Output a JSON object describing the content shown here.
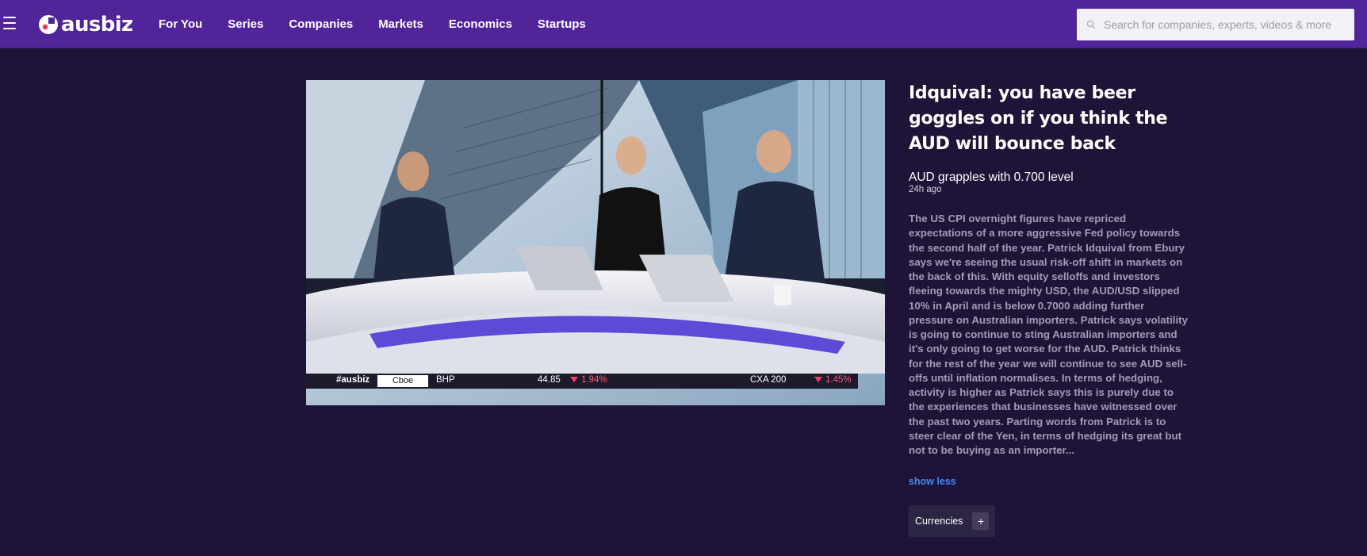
{
  "header": {
    "brand": "ausbiz",
    "nav": [
      "For You",
      "Series",
      "Companies",
      "Markets",
      "Economics",
      "Startups"
    ],
    "search_placeholder": "Search for companies, experts, videos & more"
  },
  "video": {
    "ticker": {
      "hashtag": "#ausbiz",
      "exchange": "Cboe",
      "symbol": "BHP",
      "price": "44.85",
      "change": "1.94%",
      "index": "CXA 200",
      "index_change": "1.45%"
    }
  },
  "article": {
    "title": "Idquival: you have beer goggles on if you think the AUD will bounce back",
    "subtitle": "AUD grapples with 0.700 level",
    "time_ago": "24h ago",
    "summary": "The US CPI overnight figures have repriced expectations of a more aggressive Fed policy towards the second half of the year. Patrick Idquival from Ebury says we're seeing the usual risk-off shift in markets on the back of this. With equity selloffs and investors fleeing towards the mighty USD, the AUD/USD slipped 10% in April and is below 0.7000 adding further pressure on Australian importers. Patrick says volatility is going to continue to sting Australian importers and it's only going to get worse for the AUD. Patrick thinks for the rest of the year we will continue to see AUD sell-offs until inflation normalises. In terms of hedging, activity is higher as Patrick says this is purely due to the experiences that businesses have witnessed over the past two years. Parting words from Patrick is to steer clear of the Yen, in terms of hedging its great but not to be buying as an importer...",
    "show_less": "show less",
    "tags": [
      {
        "label": "Currencies",
        "action": "+"
      }
    ]
  },
  "colors": {
    "nav_bg": "#51249a",
    "page_bg": "#1f1437",
    "link": "#3f8bff",
    "negative": "#ff3b63"
  }
}
